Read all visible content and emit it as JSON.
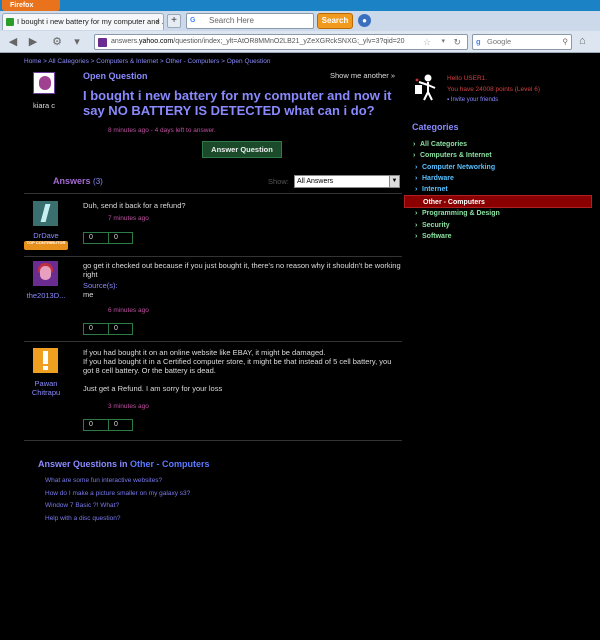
{
  "browser": {
    "app_button": "Firefox",
    "tab_title": "I bought i new battery for my computer and ...",
    "tab_close": "×",
    "new_tab": "+",
    "search_placeholder": "Search Here",
    "search_button": "Search",
    "url_prefix": "answers.",
    "url_domain": "yahoo.com",
    "url_rest": "/question/index;_ylt=AtOR8MMnO2LB21_yZeXGRckSNXG;_ylv=3?qid=20",
    "engine_search_placeholder": "Google"
  },
  "breadcrumb": [
    "Home",
    "All Categories",
    "Computers & Internet",
    "Other - Computers",
    "Open Question"
  ],
  "breadcrumb_sep": " > ",
  "asker": {
    "name": "kiara c"
  },
  "question": {
    "status": "Open Question",
    "show_more": "Show me another »",
    "title": "I bought i new battery for my computer and now it say NO BATTERY IS DETECTED what can i do?",
    "meta": "8 minutes ago - 4 days left to answer.",
    "answer_button": "Answer Question"
  },
  "answers_header": {
    "label": "Answers",
    "count": "(3)",
    "show_label": "Show:",
    "sort_value": "All Answers"
  },
  "answers": [
    {
      "name": "DrDave",
      "badge": "TOP CONTRIBUTOR",
      "text": "Duh, send it back for a refund?",
      "source_label": "",
      "source": "",
      "time": "7 minutes ago",
      "up": "0",
      "down": "0"
    },
    {
      "name": "the2013D...",
      "badge": "",
      "text": "go get it checked out because if you just bought it, there's no reason why it shouldn't be working right",
      "source_label": "Source(s):",
      "source": "me",
      "time": "6 minutes ago",
      "up": "0",
      "down": "0"
    },
    {
      "name": "Pawan Chitrapu",
      "badge": "",
      "text": "If you had bought it on an online website like EBAY, it might be damaged.\nIf you had bought it in a Certified computer store, it might be that instead of 5 cell battery, you got 8 cell battery. Or the battery is dead.\n\nJust get a Refund. I am sorry for your loss",
      "source_label": "",
      "source": "",
      "time": "3 minutes ago",
      "up": "0",
      "down": "0"
    }
  ],
  "answer_questions": {
    "label": "Answer Questions in ",
    "category": "Other - Computers",
    "items": [
      "What are some fun interactive websites?",
      "How do I make a picture smaller on my galaxy s3?",
      "Window 7 Basic ?! What?",
      "Help with a disc question?"
    ]
  },
  "user": {
    "hello": "Hello USER1.",
    "points": "You have 24008 points (Level 6)",
    "invite": "Invite your friends"
  },
  "categories": {
    "title": "Categories",
    "items": [
      {
        "label": "All Categories",
        "level": "top"
      },
      {
        "label": "Computers & Internet",
        "level": "top"
      },
      {
        "label": "Computer Networking",
        "level": "sub"
      },
      {
        "label": "Hardware",
        "level": "sub"
      },
      {
        "label": "Internet",
        "level": "sub"
      },
      {
        "label": "Other - Computers",
        "level": "selected"
      },
      {
        "label": "Programming & Design",
        "level": "subb"
      },
      {
        "label": "Security",
        "level": "subb"
      },
      {
        "label": "Software",
        "level": "subb"
      }
    ]
  },
  "icons": {
    "back": "back-arrow-icon",
    "forward": "forward-arrow-icon",
    "home": "home-icon",
    "reload": "reload-icon",
    "star": "bookmark-star-icon",
    "search": "magnifier-icon"
  },
  "colors": {
    "link": "#8a8aff",
    "question_title": "#8a8aff",
    "time": "#c050a0",
    "selected_category": "#8a0000",
    "firefox_button": "#e8731c",
    "search_button": "#f09a20"
  }
}
